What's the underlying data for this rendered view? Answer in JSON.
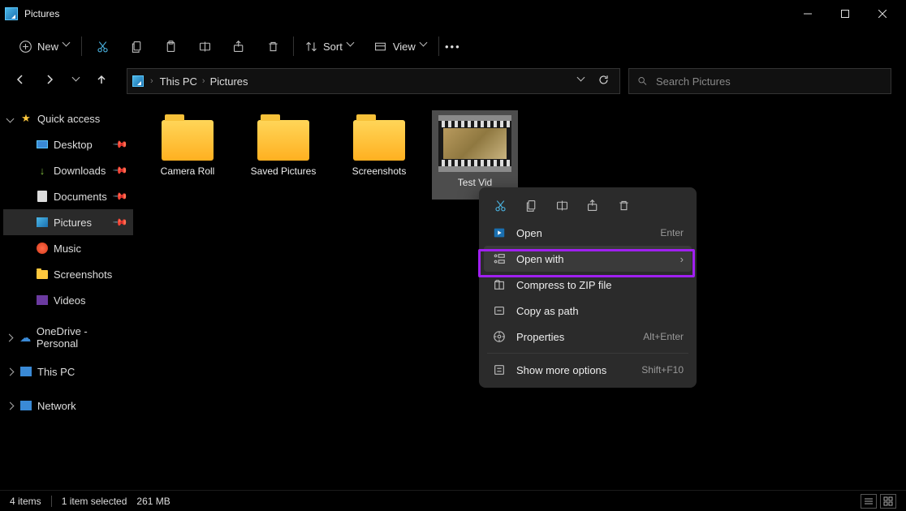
{
  "window": {
    "title": "Pictures"
  },
  "toolbar": {
    "new_label": "New",
    "sort_label": "Sort",
    "view_label": "View"
  },
  "breadcrumb": {
    "root": "This PC",
    "current": "Pictures"
  },
  "search": {
    "placeholder": "Search Pictures"
  },
  "sidebar": {
    "quick_access": "Quick access",
    "items": [
      {
        "label": "Desktop",
        "pinned": true
      },
      {
        "label": "Downloads",
        "pinned": true
      },
      {
        "label": "Documents",
        "pinned": true
      },
      {
        "label": "Pictures",
        "pinned": true,
        "active": true
      },
      {
        "label": "Music",
        "pinned": false
      },
      {
        "label": "Screenshots",
        "pinned": false
      },
      {
        "label": "Videos",
        "pinned": false
      }
    ],
    "onedrive": "OneDrive - Personal",
    "thispc": "This PC",
    "network": "Network"
  },
  "grid": {
    "items": [
      {
        "label": "Camera Roll",
        "type": "folder"
      },
      {
        "label": "Saved Pictures",
        "type": "folder"
      },
      {
        "label": "Screenshots",
        "type": "folder"
      },
      {
        "label": "Test Vid",
        "type": "video",
        "selected": true
      }
    ]
  },
  "context_menu": {
    "open": {
      "label": "Open",
      "shortcut": "Enter"
    },
    "open_with": {
      "label": "Open with"
    },
    "compress": {
      "label": "Compress to ZIP file"
    },
    "copy_path": {
      "label": "Copy as path"
    },
    "properties": {
      "label": "Properties",
      "shortcut": "Alt+Enter"
    },
    "more": {
      "label": "Show more options",
      "shortcut": "Shift+F10"
    }
  },
  "status": {
    "count": "4 items",
    "selection": "1 item selected",
    "size": "261 MB"
  }
}
